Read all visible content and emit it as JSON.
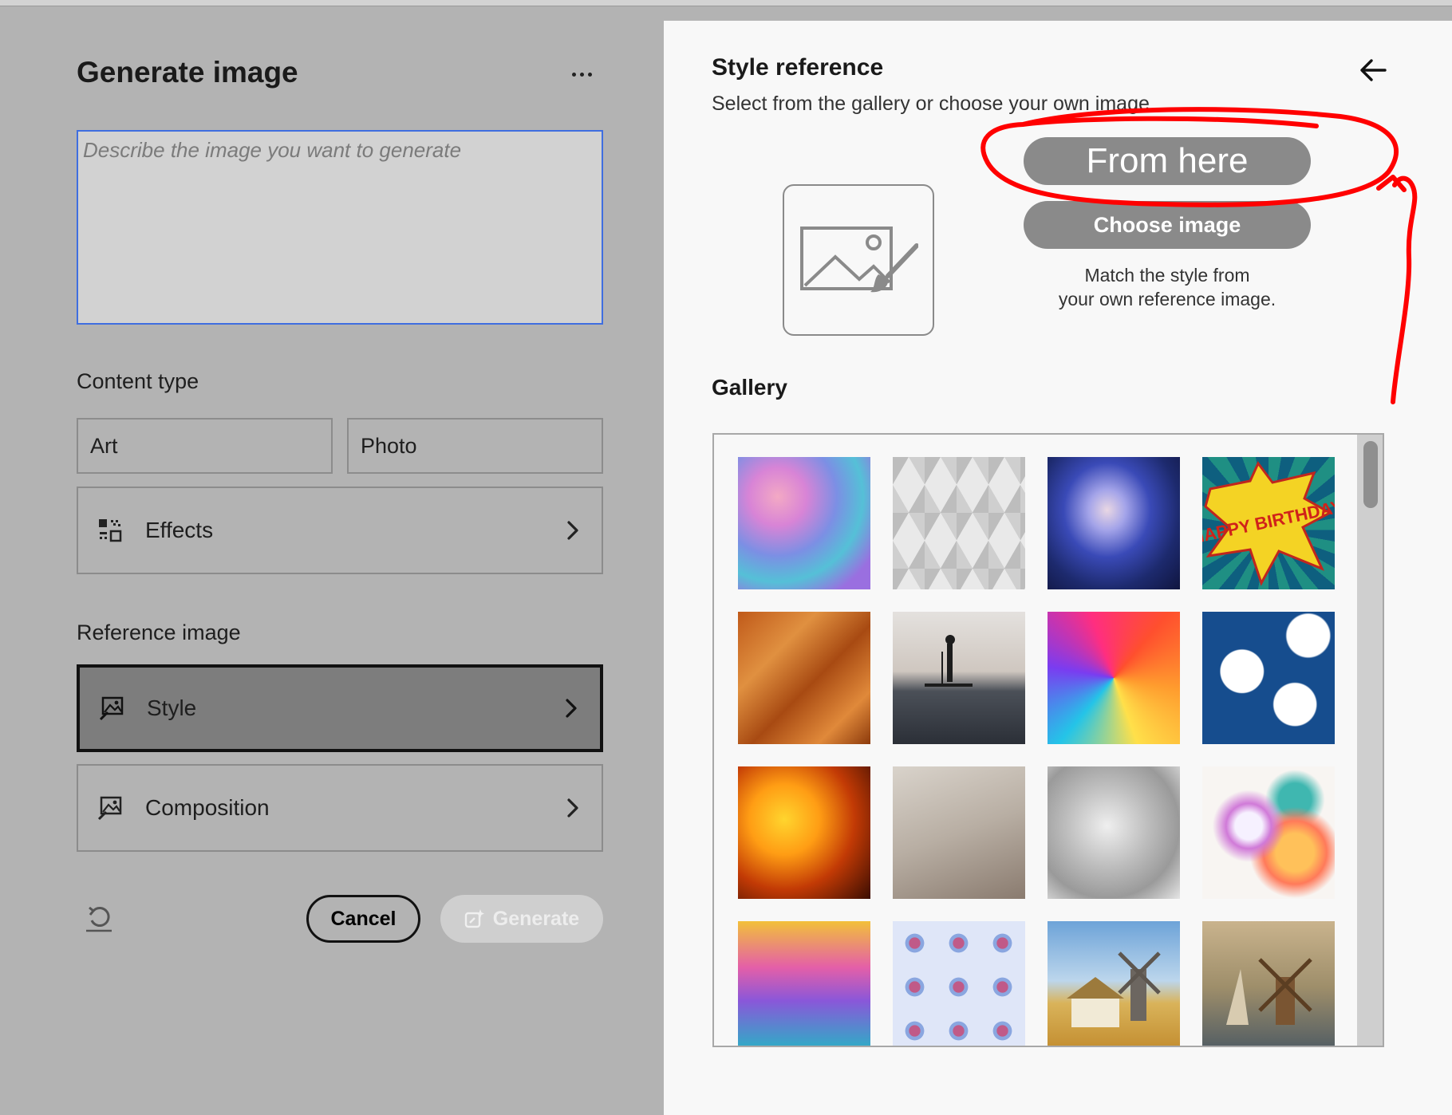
{
  "left": {
    "title": "Generate image",
    "prompt_placeholder": "Describe the image you want to generate",
    "content_type_label": "Content type",
    "content_types": [
      "Art",
      "Photo"
    ],
    "effects_label": "Effects",
    "reference_label": "Reference image",
    "style_label": "Style",
    "composition_label": "Composition",
    "cancel_label": "Cancel",
    "generate_label": "Generate"
  },
  "right": {
    "title": "Style reference",
    "subtitle": "Select from the gallery or choose your own image",
    "from_here_label": "From here",
    "choose_image_label": "Choose image",
    "hint_line1": "Match the style from",
    "hint_line2": "your own reference image.",
    "gallery_label": "Gallery",
    "thumbnails": [
      "pastel-coral",
      "white-triangles",
      "glowing-portrait",
      "happy-birthday-comic",
      "orange-diamonds",
      "paddleboard-sunset",
      "colorful-swirl",
      "clouds-on-blue",
      "orange-anemone",
      "beige-folds",
      "sketched-robot-face",
      "watercolor-daisies",
      "iridescent-bubbles",
      "pink-radios-pattern",
      "windmill-painting",
      "windmill-harbor"
    ],
    "birthday_text": "HAPPY BIRTHDAY!"
  },
  "annotation": {
    "color": "#ff0000"
  },
  "icons": {
    "more": "more-horizontal-icon",
    "back": "arrow-left-icon",
    "effects": "effects-grid-icon",
    "style": "image-style-icon",
    "composition": "image-composition-icon",
    "reset": "reset-icon",
    "generate": "generate-sparkle-icon"
  }
}
